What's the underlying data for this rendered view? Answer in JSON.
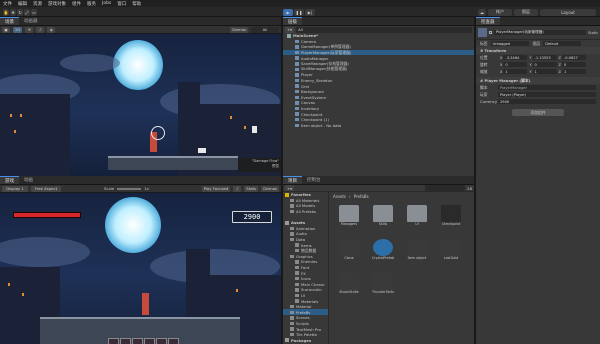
{
  "menu": [
    "文件",
    "编辑",
    "资源",
    "游戏对象",
    "组件",
    "服务",
    "Jobs",
    "窗口",
    "帮助"
  ],
  "toolbar": {
    "account_label": "帐户",
    "layers_label": "图层",
    "layout_label": "Layout"
  },
  "scene_panel": {
    "tabs": [
      "场景",
      "动画器"
    ],
    "label_2d": "2D",
    "gizmos_label": "Gizmos",
    "search_placeholder": "All",
    "camera_text": "\"Damage Flow\"",
    "camera_tooltip": "预览"
  },
  "game_panel": {
    "tabs": [
      "游戏",
      "动画"
    ],
    "display": "Display 1",
    "aspect": "Free Aspect",
    "scale_label": "Scale",
    "scale_value": "1x",
    "play_focused": "Play Focused",
    "stats": "Stats",
    "gizmos_label": "Gizmos",
    "score": "2900"
  },
  "hierarchy": {
    "tab": "层级",
    "search_placeholder": "All",
    "items": [
      {
        "label": "MainScene*",
        "depth": 0,
        "bold": true
      },
      {
        "label": "Camera",
        "depth": 1
      },
      {
        "label": "GameManager(单例管理器)",
        "depth": 1
      },
      {
        "label": "PlayerManager(玩家管理器)",
        "depth": 1,
        "selected": true
      },
      {
        "label": "AudioManager",
        "depth": 1
      },
      {
        "label": "SaveManager(存档管理器)",
        "depth": 1
      },
      {
        "label": "SkillManager(技能管理器)",
        "depth": 1
      },
      {
        "label": "Player",
        "depth": 1
      },
      {
        "label": "Enemy_Skeleton",
        "depth": 1
      },
      {
        "label": "Grid",
        "depth": 1
      },
      {
        "label": "Background",
        "depth": 1
      },
      {
        "label": "EventSystem",
        "depth": 1
      },
      {
        "label": "Canvas",
        "depth": 1
      },
      {
        "label": "Inventory",
        "depth": 1
      },
      {
        "label": "Checkpoint",
        "depth": 1
      },
      {
        "label": "Checkpoint (1)",
        "depth": 1
      },
      {
        "label": "Item object - No data",
        "depth": 1
      }
    ]
  },
  "project": {
    "tabs": [
      "项目",
      "控制台"
    ],
    "breadcrumb": [
      "Assets",
      "PrefaBs"
    ],
    "count": "28",
    "tree": [
      {
        "label": "Favorites",
        "depth": 0,
        "bold": true
      },
      {
        "label": "All Materials",
        "depth": 1
      },
      {
        "label": "All Models",
        "depth": 1
      },
      {
        "label": "All Prefabs",
        "depth": 1
      },
      {
        "label": "",
        "depth": 0
      },
      {
        "label": "Assets",
        "depth": 0,
        "bold": true
      },
      {
        "label": "Animation",
        "depth": 1
      },
      {
        "label": "Audio",
        "depth": 1
      },
      {
        "label": "Data",
        "depth": 1
      },
      {
        "label": "Items",
        "depth": 2
      },
      {
        "label": "物品数据",
        "depth": 2
      },
      {
        "label": "Graphics",
        "depth": 1
      },
      {
        "label": "Enemies",
        "depth": 2
      },
      {
        "label": "Font",
        "depth": 2
      },
      {
        "label": "FX",
        "depth": 2
      },
      {
        "label": "Icons",
        "depth": 2
      },
      {
        "label": "Main Charac",
        "depth": 2
      },
      {
        "label": "Surroundin",
        "depth": 2
      },
      {
        "label": "UI",
        "depth": 2
      },
      {
        "label": "Materials",
        "depth": 2
      },
      {
        "label": "Material",
        "depth": 1
      },
      {
        "label": "PrefaBs",
        "depth": 1,
        "selected": true
      },
      {
        "label": "Scenes",
        "depth": 1
      },
      {
        "label": "Scripts",
        "depth": 1
      },
      {
        "label": "TextMesh Pro",
        "depth": 1
      },
      {
        "label": "Tile Palette",
        "depth": 1
      },
      {
        "label": "Packages",
        "depth": 0,
        "bold": true
      }
    ],
    "assets": [
      {
        "label": "Managers",
        "kind": "folder"
      },
      {
        "label": "Skills",
        "kind": "folder"
      },
      {
        "label": "UI",
        "kind": "folder"
      },
      {
        "label": "Checkpoint",
        "kind": "checkpoint"
      },
      {
        "label": "Clone",
        "kind": "sprite"
      },
      {
        "label": "CrystalPrefab",
        "kind": "crystal"
      },
      {
        "label": "Item object",
        "kind": "item"
      },
      {
        "label": "LostGold",
        "kind": "gold"
      },
      {
        "label": "ShockStrike",
        "kind": "shock"
      },
      {
        "label": "ThunderStrike",
        "kind": "thunder"
      }
    ]
  },
  "inspector": {
    "tab": "检查器",
    "object_name": "PlayerManager(玩家管理器)",
    "static_label": "Static",
    "tag_label": "标签",
    "tag_value": "Untagged",
    "layer_label": "图层",
    "layer_value": "Default",
    "transform": {
      "title": "Transform",
      "position_label": "位置",
      "rotation_label": "旋转",
      "scale_label": "缩放",
      "position": {
        "x": "-3.2464",
        "y": "-1.13553",
        "z": "-0.0627"
      },
      "rotation": {
        "x": "0",
        "y": "0",
        "z": "0"
      },
      "scale": {
        "x": "1",
        "y": "1",
        "z": "1"
      }
    },
    "script_component": {
      "title": "Player Manager (脚本)",
      "script_label": "脚本",
      "script_value": "PlayerManager",
      "player_label": "玩家",
      "player_value": "Player (Player)",
      "currency_label": "Currency",
      "currency_value": "2900"
    },
    "add_component": "添加组件"
  }
}
